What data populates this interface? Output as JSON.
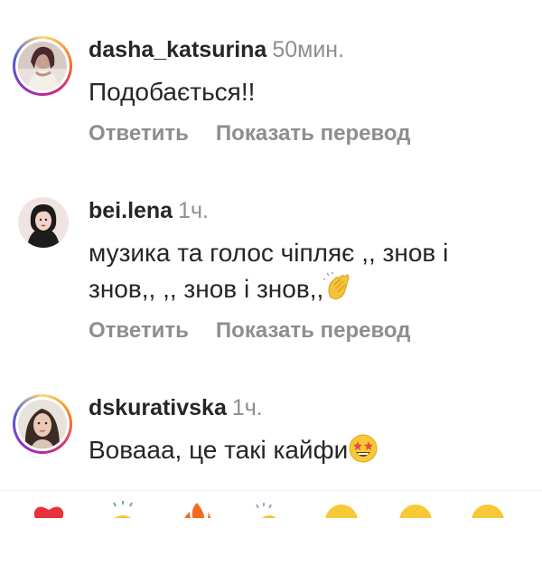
{
  "comments": [
    {
      "username": "dasha_katsurina",
      "time": "50мин.",
      "text": "Подобається!!",
      "reply_label": "Ответить",
      "translate_label": "Показать перевод",
      "has_story_ring": true
    },
    {
      "username": "bei.lena",
      "time": "1ч.",
      "text_line1": "музика та голос чіпляє ,, знов і",
      "text_line2": "знов,, ,, знов і знов,,",
      "emoji": "clapping-hands",
      "reply_label": "Ответить",
      "translate_label": "Показать перевод",
      "has_story_ring": false
    },
    {
      "username": "dskurativska",
      "time": "1ч.",
      "text": "Вовааа, це такі кайфи",
      "emoji": "star-struck",
      "has_story_ring": true
    }
  ],
  "reactions": [
    "red-heart",
    "raising-hands",
    "fire",
    "clapping-hands",
    "crying-face",
    "heart-eyes",
    "smiling-face"
  ],
  "colors": {
    "primary_text": "#262626",
    "secondary_text": "#8e8e8e",
    "ring_gradient": [
      "#feda75",
      "#fa7e1e",
      "#d62976",
      "#962fbf",
      "#4f5bd5"
    ]
  }
}
